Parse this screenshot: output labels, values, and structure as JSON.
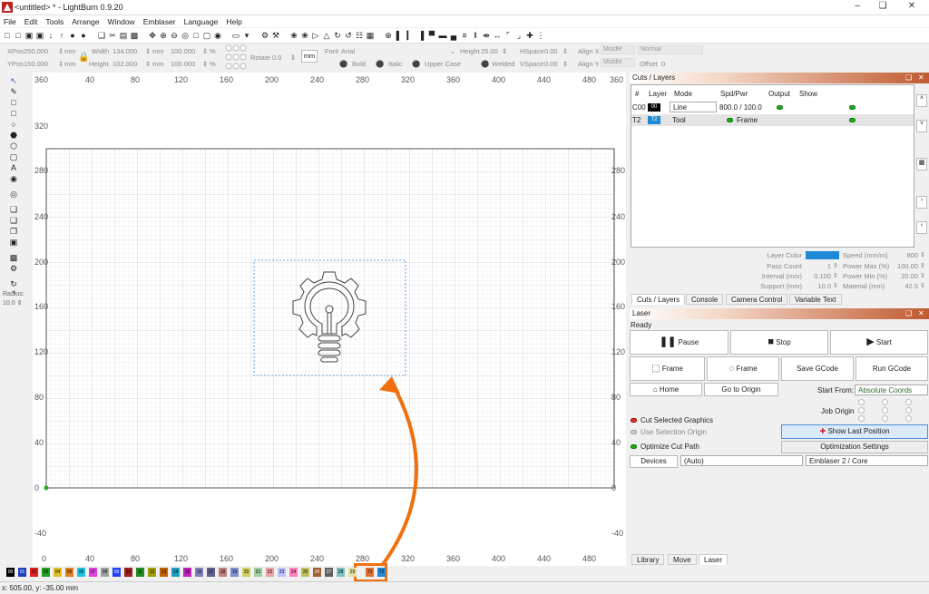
{
  "window": {
    "title": "<untitled> * - LightBurn 0.9.20"
  },
  "menu": [
    "File",
    "Edit",
    "Tools",
    "Arrange",
    "Window",
    "Emblaser",
    "Language",
    "Help"
  ],
  "props": {
    "xpos_label": "XPos",
    "xpos_value": "250.000",
    "xpos_unit": "mm",
    "ypos_label": "YPos",
    "ypos_value": "150.000",
    "ypos_unit": "mm",
    "width_label": "Width",
    "width_value": "134.000",
    "width_unit": "mm",
    "width_pct": "100.000",
    "width_pct_unit": "%",
    "height_label": "Height",
    "height_value": "102.000",
    "height_unit": "mm",
    "height_pct": "100.000",
    "height_pct_unit": "%",
    "rotate_label": "Rotate",
    "rotate_value": "0.0",
    "units_button": "mm",
    "font_label": "Font",
    "font_value": "Arial",
    "fheight_label": "Height",
    "fheight_value": "25.00",
    "hspace_label": "HSpace",
    "hspace_value": "0.00",
    "vspace_label": "VSpace",
    "vspace_value": "0.00",
    "alignx_label": "Align X",
    "alignx_value": "Middle",
    "aligny_label": "Align Y",
    "aligny_value": "Middle",
    "normal_value": "Normal",
    "offset_label": "Offset",
    "offset_value": "0",
    "bold": "Bold",
    "italic": "Italic",
    "uppercase": "Upper Case",
    "welded": "Welded"
  },
  "radius": {
    "label": "Radius:",
    "value": "10.0"
  },
  "ruler": {
    "top": [
      "360",
      "40",
      "80",
      "120",
      "160",
      "200",
      "240",
      "280",
      "320",
      "360",
      "400",
      "440",
      "480",
      "360"
    ],
    "bottom": [
      "0",
      "40",
      "80",
      "120",
      "160",
      "200",
      "240",
      "280",
      "320",
      "360",
      "400",
      "440",
      "480"
    ],
    "left": [
      "320",
      "280",
      "240",
      "200",
      "160",
      "120",
      "80",
      "40",
      "0",
      "-40"
    ],
    "right": [
      "280",
      "240",
      "200",
      "160",
      "120",
      "80",
      "40",
      "0",
      "-40"
    ]
  },
  "palette": [
    "00",
    "01",
    "02",
    "03",
    "04",
    "05",
    "06",
    "07",
    "08",
    "09",
    "10",
    "11",
    "12",
    "13",
    "14",
    "15",
    "16",
    "17",
    "18",
    "19",
    "20",
    "21",
    "22",
    "23",
    "24",
    "25",
    "26",
    "27",
    "28",
    "29",
    "T1",
    "T2"
  ],
  "palette_colors": [
    "#000000",
    "#1f3fbf",
    "#e02020",
    "#20a020",
    "#e0c020",
    "#e08020",
    "#20c0e0",
    "#e040e0",
    "#a0a0a0",
    "#2040ff",
    "#a02020",
    "#209020",
    "#a0a000",
    "#c06000",
    "#20a0c0",
    "#c020c0",
    "#8080c0",
    "#606090",
    "#c08080",
    "#8090d0",
    "#d0d060",
    "#a0d0a0",
    "#f0a0a0",
    "#c0c0ff",
    "#ff80c0",
    "#c0c060",
    "#a06030",
    "#606060",
    "#80c0c0",
    "#e0e0a0",
    "#e07030",
    "#1e8ad6"
  ],
  "status": {
    "coords": "x: 505.00, y: -35.00 mm"
  },
  "cuts": {
    "title": "Cuts / Layers",
    "headers": [
      "#",
      "Layer",
      "Mode",
      "Spd/Pwr",
      "Output",
      "Show"
    ],
    "rows": [
      {
        "num": "C00",
        "layer": "00",
        "mode": "Line",
        "spdpwr": "800.0 / 100.0"
      },
      {
        "num": "T2",
        "layer": "T2",
        "mode": "Tool",
        "spdpwr": "Frame"
      }
    ],
    "props": [
      {
        "label": "Layer Color",
        "value": ""
      },
      {
        "label": "Pass Count",
        "value": "1"
      },
      {
        "label": "Interval (mm)",
        "value": "0.100"
      },
      {
        "label": "Support (mm)",
        "value": "10.0"
      }
    ],
    "props2": [
      {
        "label": "Speed (mm/m)",
        "value": "800"
      },
      {
        "label": "Power Max (%)",
        "value": "100.00"
      },
      {
        "label": "Power Min (%)",
        "value": "20.00"
      },
      {
        "label": "Material (mm)",
        "value": "42.5"
      }
    ]
  },
  "tabs": [
    "Cuts / Layers",
    "Console",
    "Camera Control",
    "Variable Text"
  ],
  "laser": {
    "title": "Laser",
    "state": "Ready",
    "pause": "Pause",
    "stop": "Stop",
    "start": "Start",
    "frame1": "Frame",
    "frame2": "Frame",
    "save_gcode": "Save GCode",
    "run_gcode": "Run GCode",
    "home": "Home",
    "go_origin": "Go to Origin",
    "start_from_label": "Start From:",
    "start_from_value": "Absolute Coords",
    "job_origin": "Job Origin",
    "cut_selected": "Cut Selected Graphics",
    "use_selection_origin": "Use Selection Origin",
    "optimize_cut": "Optimize Cut Path",
    "show_last": "Show Last Position",
    "opt_settings": "Optimization Settings",
    "devices": "Devices",
    "auto": "(Auto)",
    "device": "Emblaser 2 / Core"
  },
  "bottom_tabs": [
    "Library",
    "Move",
    "Laser"
  ]
}
